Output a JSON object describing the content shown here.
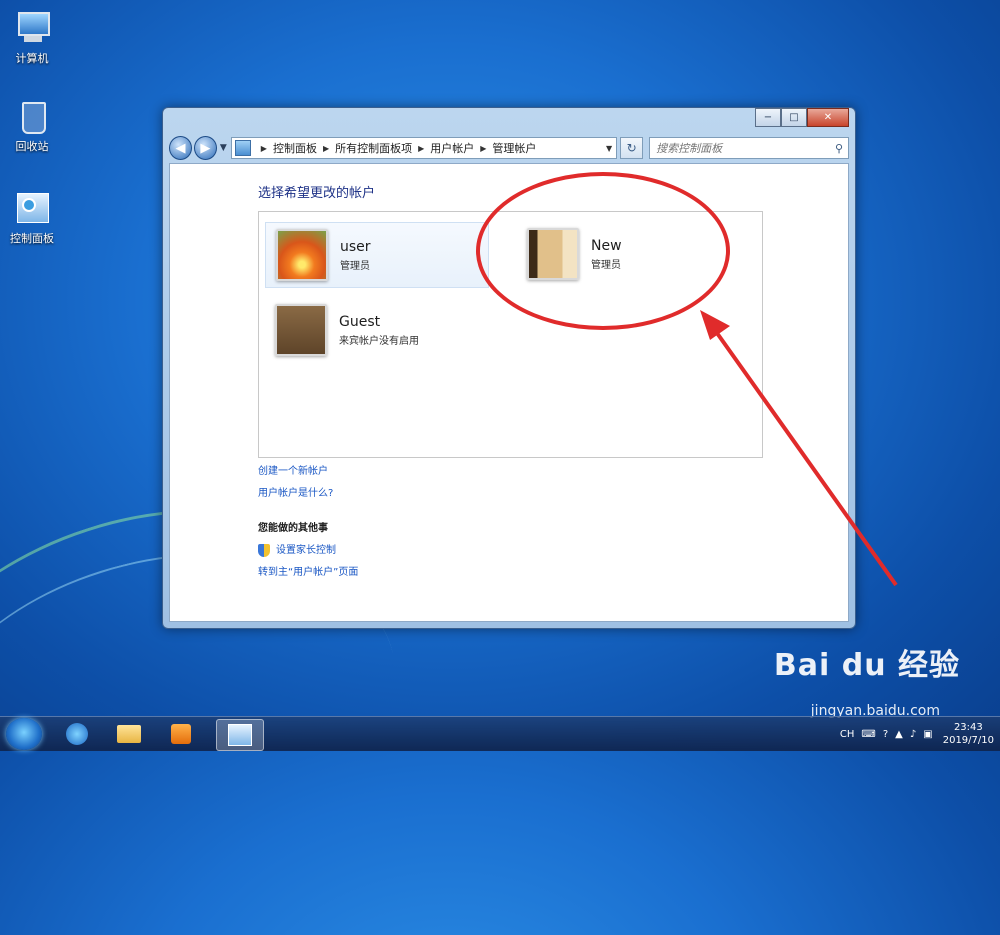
{
  "desktop": {
    "icons": [
      {
        "label": "计算机"
      },
      {
        "label": "回收站"
      },
      {
        "label": "控制面板"
      }
    ]
  },
  "window": {
    "caption": {
      "minimize": "−",
      "maximize": "□",
      "close": "✕"
    },
    "nav": {
      "back": "◀",
      "forward": "▶"
    },
    "breadcrumb": [
      "控制面板",
      "所有控制面板项",
      "用户帐户",
      "管理帐户"
    ],
    "search_placeholder": "搜索控制面板",
    "heading": "选择希望更改的帐户",
    "accounts": [
      {
        "name": "user",
        "role": "管理员"
      },
      {
        "name": "New",
        "role": "管理员"
      },
      {
        "name": "Guest",
        "role": "来宾帐户没有启用"
      }
    ],
    "links": [
      "创建一个新帐户",
      "用户帐户是什么?"
    ],
    "other_title": "您能做的其他事",
    "other_links": [
      "设置家长控制",
      "转到主“用户帐户”页面"
    ]
  },
  "taskbar": {
    "tray": {
      "lang": "CH",
      "help": "?"
    },
    "clock": {
      "time": "23:43",
      "date": "2019/7/10"
    }
  },
  "watermark": {
    "brand": "Bai du 经验",
    "url": "jingyan.baidu.com"
  },
  "colors": {
    "annotation": "#e02b2b",
    "link": "#1a57c4",
    "heading": "#1e3287"
  }
}
